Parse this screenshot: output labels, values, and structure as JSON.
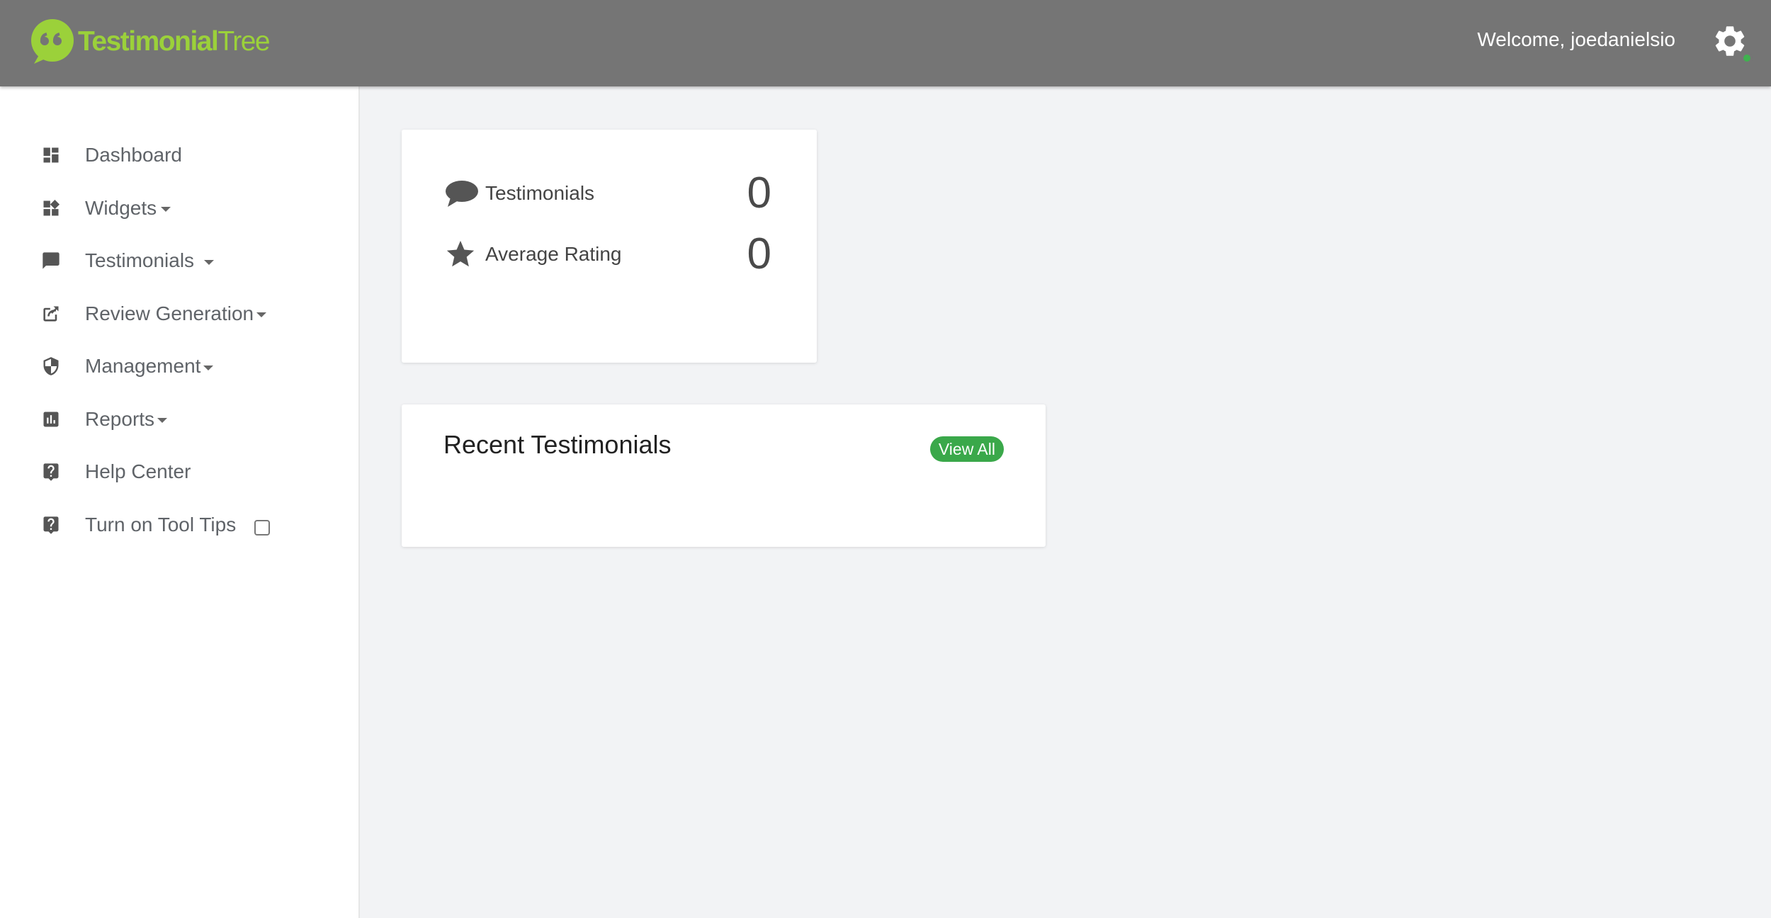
{
  "brand": {
    "name_part1": "Testimonial",
    "name_part2": "Tree",
    "color": "#9bd13a"
  },
  "header": {
    "welcome": "Welcome, joedanielsio",
    "status_color": "#3fb14f"
  },
  "sidebar": {
    "items": [
      {
        "label": "Dashboard",
        "icon": "dashboard-icon",
        "has_caret": false
      },
      {
        "label": "Widgets",
        "icon": "widgets-icon",
        "has_caret": true
      },
      {
        "label": "Testimonials",
        "icon": "comment-icon",
        "has_caret": true
      },
      {
        "label": "Review Generation",
        "icon": "share-icon",
        "has_caret": true
      },
      {
        "label": "Management",
        "icon": "shield-icon",
        "has_caret": true
      },
      {
        "label": "Reports",
        "icon": "bar-chart-icon",
        "has_caret": true
      },
      {
        "label": "Help Center",
        "icon": "help-icon",
        "has_caret": false
      },
      {
        "label": "Turn on Tool Tips",
        "icon": "help-icon",
        "has_caret": false,
        "checkbox_checked": false
      }
    ]
  },
  "stats": {
    "testimonials_label": "Testimonials",
    "testimonials_value": "0",
    "rating_label": "Average Rating",
    "rating_value": "0"
  },
  "recent": {
    "title": "Recent Testimonials",
    "view_all": "View All",
    "badge_color": "#3aa84a"
  }
}
